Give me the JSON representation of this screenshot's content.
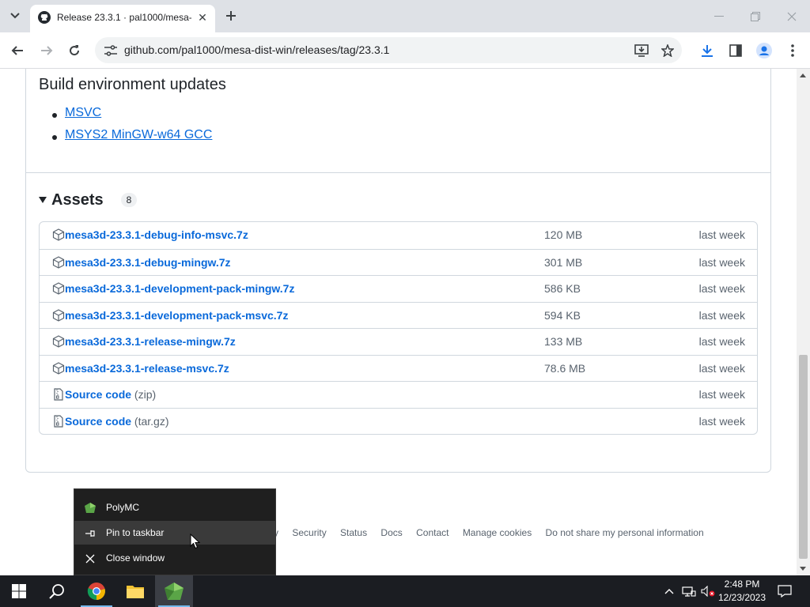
{
  "browser": {
    "tab_title": "Release 23.3.1 · pal1000/mesa-d",
    "url": "github.com/pal1000/mesa-dist-win/releases/tag/23.3.1"
  },
  "content": {
    "build_env_title": "Build environment updates",
    "build_env_items": [
      "MSVC",
      "MSYS2 MinGW-w64 GCC"
    ],
    "assets_title": "Assets",
    "assets_count": "8",
    "assets": [
      {
        "name": "mesa3d-23.3.1-debug-info-msvc.7z",
        "suffix": "",
        "size": "120 MB",
        "date": "last week",
        "icon": "package-icon"
      },
      {
        "name": "mesa3d-23.3.1-debug-mingw.7z",
        "suffix": "",
        "size": "301 MB",
        "date": "last week",
        "icon": "package-icon"
      },
      {
        "name": "mesa3d-23.3.1-development-pack-mingw.7z",
        "suffix": "",
        "size": "586 KB",
        "date": "last week",
        "icon": "package-icon"
      },
      {
        "name": "mesa3d-23.3.1-development-pack-msvc.7z",
        "suffix": "",
        "size": "594 KB",
        "date": "last week",
        "icon": "package-icon"
      },
      {
        "name": "mesa3d-23.3.1-release-mingw.7z",
        "suffix": "",
        "size": "133 MB",
        "date": "last week",
        "icon": "package-icon"
      },
      {
        "name": "mesa3d-23.3.1-release-msvc.7z",
        "suffix": "",
        "size": "78.6 MB",
        "date": "last week",
        "icon": "package-icon"
      },
      {
        "name": "Source code",
        "suffix": "(zip)",
        "size": "",
        "date": "last week",
        "icon": "file-zip-icon"
      },
      {
        "name": "Source code",
        "suffix": "(tar.gz)",
        "size": "",
        "date": "last week",
        "icon": "file-zip-icon"
      }
    ]
  },
  "footer": {
    "links": [
      "cy",
      "Security",
      "Status",
      "Docs",
      "Contact",
      "Manage cookies",
      "Do not share my personal information"
    ]
  },
  "jumplist": {
    "app_name": "PolyMC",
    "pin_label": "Pin to taskbar",
    "close_label": "Close window"
  },
  "taskbar": {
    "time": "2:48 PM",
    "date": "12/23/2023"
  },
  "colors": {
    "link": "#0969da",
    "taskbar": "#1b1d22",
    "jumplist_bg": "#1f1f1f"
  }
}
